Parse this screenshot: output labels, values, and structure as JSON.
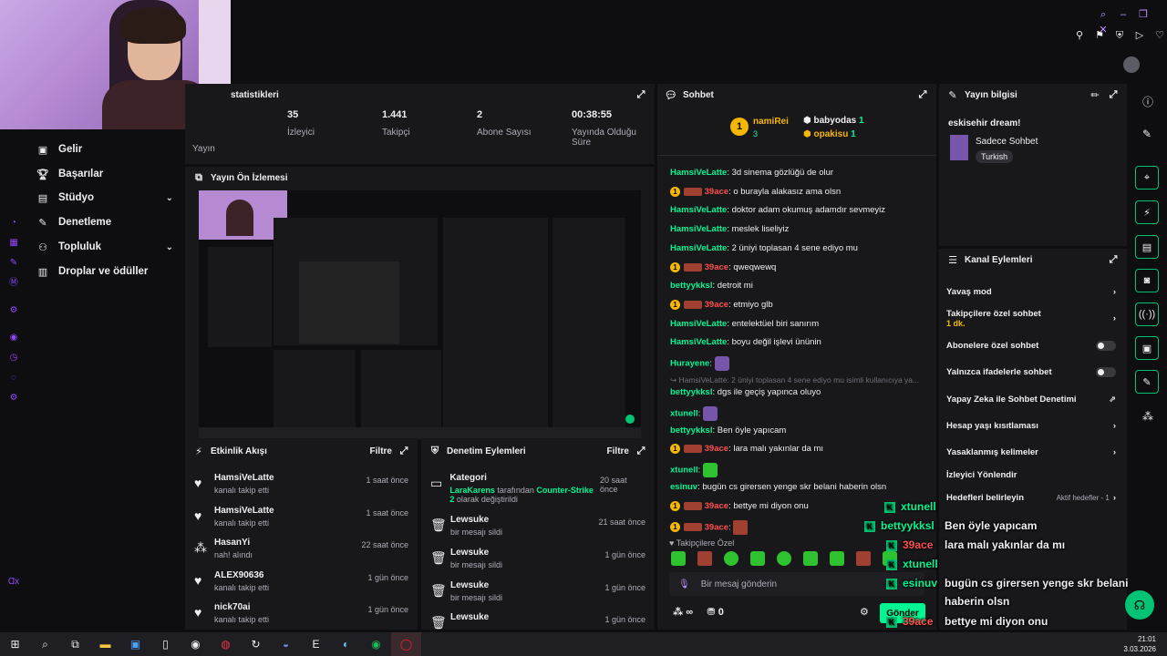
{
  "topbar": {
    "icons": [
      "search-icon",
      "minimize-icon",
      "restore-icon",
      "close-icon",
      "heart-icon"
    ],
    "row2_icons": [
      "pin-icon",
      "bookmark-icon",
      "shield-icon",
      "play-icon",
      "heart-outline-icon",
      "divider"
    ]
  },
  "sidebar": {
    "items": [
      {
        "label": "Gelir",
        "icon": "revenue-icon"
      },
      {
        "label": "Başarılar",
        "icon": "trophy-icon"
      },
      {
        "label": "Stüdyo",
        "icon": "studio-icon",
        "expandable": true
      },
      {
        "label": "Denetleme",
        "icon": "wrench-icon"
      },
      {
        "label": "Topluluk",
        "icon": "community-icon",
        "expandable": true
      },
      {
        "label": "Droplar ve ödüller",
        "icon": "gift-icon"
      }
    ],
    "footer": "Ɑx"
  },
  "stats": {
    "title": "statistikleri",
    "items": [
      {
        "value": "",
        "label": "Yayın"
      },
      {
        "value": "35",
        "label": "İzleyici"
      },
      {
        "value": "1.441",
        "label": "Takipçi"
      },
      {
        "value": "2",
        "label": "Abone Sayısı"
      },
      {
        "value": "00:38:55",
        "label": "Yayında Olduğu Süre"
      }
    ]
  },
  "preview": {
    "title": "Yayın Ön İzlemesi"
  },
  "activity": {
    "title": "Etkinlik Akışı",
    "filter": "Filtre",
    "rows": [
      {
        "name": "HamsiVeLatte",
        "desc": "kanalı takip etti",
        "time": "1 saat önce",
        "icon": "heart-icon"
      },
      {
        "name": "HamsiVeLatte",
        "desc": "kanalı takip etti",
        "time": "1 saat önce",
        "icon": "heart-icon"
      },
      {
        "name": "HasanYi",
        "desc": "nah! alındı",
        "time": "22 saat önce",
        "icon": "points-icon"
      },
      {
        "name": "ALEX90636",
        "desc": "kanalı takip etti",
        "time": "1 gün önce",
        "icon": "heart-icon"
      },
      {
        "name": "nick70ai",
        "desc": "kanalı takip etti",
        "time": "1 gün önce",
        "icon": "heart-icon"
      }
    ]
  },
  "moderation": {
    "title": "Denetim Eylemleri",
    "filter": "Filtre",
    "rows": [
      {
        "name": "Kategori",
        "desc_user": "LaraKarens",
        "desc_mid": " tarafından ",
        "desc_game": "Counter-Strike 2",
        "desc_end": " olarak değiştirildi",
        "time": "20 saat önce",
        "icon": "category-icon"
      },
      {
        "name": "Lewsuke",
        "desc": "bir mesajı sildi",
        "time": "21 saat önce",
        "icon": "trash-icon"
      },
      {
        "name": "Lewsuke",
        "desc": "bir mesajı sildi",
        "time": "1 gün önce",
        "icon": "trash-icon"
      },
      {
        "name": "Lewsuke",
        "desc": "bir mesajı sildi",
        "time": "1 gün önce",
        "icon": "trash-icon"
      },
      {
        "name": "Lewsuke",
        "desc": "",
        "time": "1 gün önce",
        "icon": "trash-icon"
      }
    ]
  },
  "chat": {
    "title": "Sohbet",
    "leaderboard": [
      {
        "name": "namiRei",
        "count": "3",
        "rank": "1"
      },
      {
        "name": "babyodas",
        "count": "1"
      },
      {
        "name": "opakisu",
        "count": "1"
      }
    ],
    "messages": [
      {
        "user": "HamsiVeLatte",
        "text": "3d sinema gözlüğü de olur",
        "color": "#00f593",
        "badge": false
      },
      {
        "user": "39ace",
        "text": "o burayla alakasız ama olsn",
        "color": "#ff4f4d",
        "badge": true
      },
      {
        "user": "HamsiVeLatte",
        "text": "doktor adam okumuş adamdır sevmeyiz",
        "color": "#00f593",
        "badge": false
      },
      {
        "user": "HamsiVeLatte",
        "text": "meslek liseliyiz",
        "color": "#00f593",
        "badge": false
      },
      {
        "user": "HamsiVeLatte",
        "text": "2 üniyi toplasan 4 sene ediyo mu",
        "color": "#00f593",
        "badge": false
      },
      {
        "user": "39ace",
        "text": "qweqwewq",
        "color": "#ff4f4d",
        "badge": true
      },
      {
        "user": "bettyykksl",
        "text": "detroit mi",
        "color": "#00f593",
        "badge": false
      },
      {
        "user": "39ace",
        "text": "etmiyo glb",
        "color": "#ff4f4d",
        "badge": true
      },
      {
        "user": "HamsiVeLatte",
        "text": "entelektüel biri sanırım",
        "color": "#00f593",
        "badge": false
      },
      {
        "user": "HamsiVeLatte",
        "text": "boyu değil işlevi ününin",
        "color": "#00f593",
        "badge": false
      },
      {
        "user": "Hurayene",
        "text": "",
        "color": "#00f593",
        "badge": false,
        "emote": true
      },
      {
        "user": "bettyykksl",
        "text": "dgs ile geçiş yapınca oluyo",
        "color": "#00f593",
        "badge": false,
        "reply": "↪ HamsiVeLatte: 2 üniyi toplasan 4 sene ediyo mu isimli kullanıcıya ya..."
      },
      {
        "user": "xtunell",
        "text": "",
        "color": "#00f593",
        "badge": false,
        "emote": true
      },
      {
        "user": "bettyykksl",
        "text": "Ben öyle yapıcam",
        "color": "#00f593",
        "badge": false
      },
      {
        "user": "39ace",
        "text": "lara malı yakınlar da mı",
        "color": "#ff4f4d",
        "badge": true
      },
      {
        "user": "xtunell",
        "text": "",
        "color": "#00f593",
        "badge": false,
        "gemote": true
      },
      {
        "user": "esinuv",
        "text": "bugün cs girersen yenge skr belani haberin olsn",
        "color": "#00f593",
        "badge": false
      },
      {
        "user": "39ace",
        "text": "bettye mi diyon onu",
        "color": "#ff4f4d",
        "badge": true
      },
      {
        "user": "39ace",
        "text": "",
        "color": "#ff4f4d",
        "badge": true,
        "remote": true
      }
    ],
    "followers_only": "Takipçilere Özel",
    "input_placeholder": "Bir mesaj gönderin",
    "points": "0",
    "send_label": "Gönder"
  },
  "stream_info": {
    "title": "Yayın bilgisi",
    "stream_title": "eskisehir dream!",
    "category": "Sadece Sohbet",
    "tag": "Turkish"
  },
  "channel_actions": {
    "title": "Kanal Eylemleri",
    "items": [
      {
        "label": "Yavaş mod",
        "control": "chevron"
      },
      {
        "label": "Takipçilere özel sohbet",
        "sub": "1 dk.",
        "control": "chevron"
      },
      {
        "label": "Abonelere özel sohbet",
        "control": "toggle"
      },
      {
        "label": "Yalnızca ifadelerle sohbet",
        "control": "toggle"
      },
      {
        "label": "Yapay Zeka ile Sohbet Denetimi",
        "control": "external"
      },
      {
        "label": "Hesap yaşı kısıtlaması",
        "control": "chevron"
      },
      {
        "label": "Yasaklanmış kelimeler",
        "control": "chevron"
      },
      {
        "label": "İzleyici Yönlendir",
        "control": "none"
      },
      {
        "label": "Hedefleri belirleyin",
        "control": "chevron",
        "extra": "Aktif hedefler - 1"
      }
    ]
  },
  "overlay_chat": [
    {
      "user": "xtunell",
      "text": "",
      "color": "#00f593"
    },
    {
      "user": "bettyykksl",
      "text": "Ben öyle yapıcam",
      "color": "#00f593"
    },
    {
      "user": "39ace",
      "text": "lara malı yakınlar da mı",
      "color": "#ff4f4d"
    },
    {
      "user": "xtunell",
      "text": "",
      "color": "#00f593"
    },
    {
      "user": "esinuv",
      "text": "bugün cs girersen yenge skr belani",
      "text2": "haberin olsn",
      "color": "#00f593"
    },
    {
      "user": "39ace",
      "text": "bettye mi diyon onu",
      "color": "#ff4f4d"
    },
    {
      "user": "39ace",
      "text": "",
      "color": "#ff4f4d"
    }
  ],
  "taskbar": {
    "time": "21:01",
    "date": "3.03.2026"
  },
  "colors": {
    "accent": "#00c473",
    "kick_green": "#00f593",
    "purple": "#9147ff",
    "red": "#ff4f4d"
  }
}
